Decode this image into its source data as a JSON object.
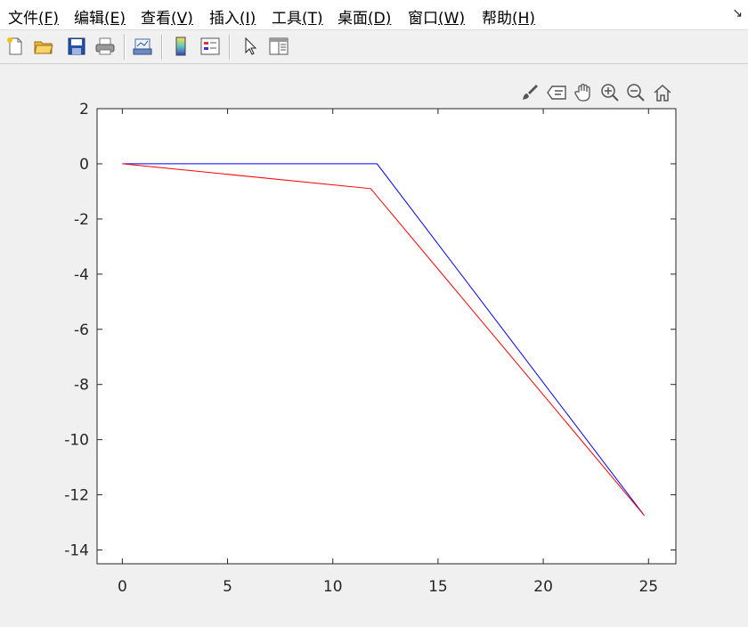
{
  "menubar": {
    "items": [
      {
        "name": "file",
        "label": "文件",
        "key": "(F)",
        "left": 9
      },
      {
        "name": "edit",
        "label": "编辑",
        "key": "(E)",
        "left": 83
      },
      {
        "name": "view",
        "label": "查看",
        "key": "(V)",
        "left": 158
      },
      {
        "name": "insert",
        "label": "插入",
        "key": "(I)",
        "left": 235
      },
      {
        "name": "tools",
        "label": "工具",
        "key": "(T)",
        "left": 305
      },
      {
        "name": "desktop",
        "label": "桌面",
        "key": "(D)",
        "left": 379
      },
      {
        "name": "window",
        "label": "窗口",
        "key": "(W)",
        "left": 458
      },
      {
        "name": "help",
        "label": "帮助",
        "key": "(H)",
        "left": 541
      }
    ],
    "dock_glyph": "↘"
  },
  "toolbar": {
    "icons": [
      "new-figure-icon",
      "open-file-icon",
      "save-icon",
      "print-icon",
      "link-plot-icon",
      "insert-colorbar-icon",
      "insert-legend-icon",
      "edit-plot-arrow-icon",
      "property-inspector-icon"
    ]
  },
  "axes_toolbar": {
    "icons": [
      "brush-icon",
      "data-tips-icon",
      "pan-hand-icon",
      "zoom-in-icon",
      "zoom-out-icon",
      "home-restore-view-icon"
    ]
  },
  "chart_data": {
    "type": "line",
    "title": "",
    "xlabel": "",
    "ylabel": "",
    "xlim": [
      -1.2,
      26.3
    ],
    "ylim": [
      -14.5,
      2
    ],
    "xticks": [
      0,
      5,
      10,
      15,
      20,
      25
    ],
    "yticks": [
      2,
      0,
      -2,
      -4,
      -6,
      -8,
      -10,
      -12,
      -14
    ],
    "grid": false,
    "series": [
      {
        "color": "#0000ff",
        "x": [
          0,
          12.1,
          24.8
        ],
        "y": [
          0,
          0,
          -12.75
        ]
      },
      {
        "color": "#ff0000",
        "x": [
          0,
          11.8,
          24.8
        ],
        "y": [
          0,
          -0.9,
          -12.75
        ]
      }
    ]
  }
}
